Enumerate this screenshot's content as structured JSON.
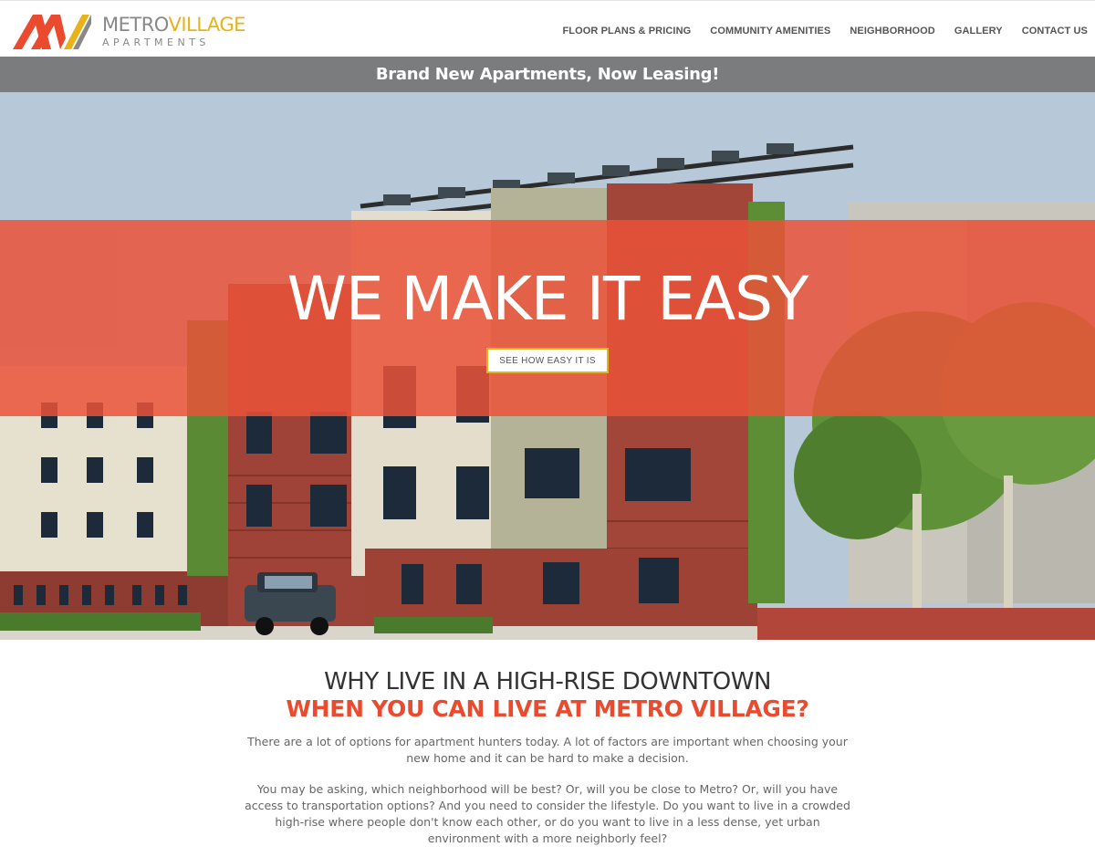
{
  "brand": {
    "name_part1": "METRO",
    "name_part2": "VILLAGE",
    "tagline": "APARTMENTS",
    "colors": {
      "accent": "#ea4b2f",
      "gold": "#e8b21a",
      "gray": "#888888"
    }
  },
  "nav": {
    "items": [
      {
        "label": "FLOOR PLANS & PRICING"
      },
      {
        "label": "COMMUNITY AMENITIES"
      },
      {
        "label": "NEIGHBORHOOD"
      },
      {
        "label": "GALLERY"
      },
      {
        "label": "CONTACT US"
      }
    ]
  },
  "banner": {
    "text": "Brand New Apartments, Now Leasing!"
  },
  "hero": {
    "title": "WE MAKE IT EASY",
    "button_label": "SEE HOW EASY IT IS",
    "overlay_color": "#ea5238"
  },
  "intro": {
    "heading_line1": "WHY LIVE IN A HIGH-RISE DOWNTOWN",
    "heading_line2": "WHEN YOU CAN LIVE AT METRO VILLAGE?",
    "paragraph1": "There are a lot of options for apartment hunters today.  A lot of factors are important when choosing your new home and it can be hard to make a decision.",
    "paragraph2": "You may be asking, which neighborhood will be best?  Or, will you be close to Metro?  Or, will you have access to transportation options?  And you need to consider the lifestyle.  Do you want to live in a crowded high-rise where people don't know each other, or do you want to live in a less dense, yet urban environment with a more neighborly feel?"
  }
}
